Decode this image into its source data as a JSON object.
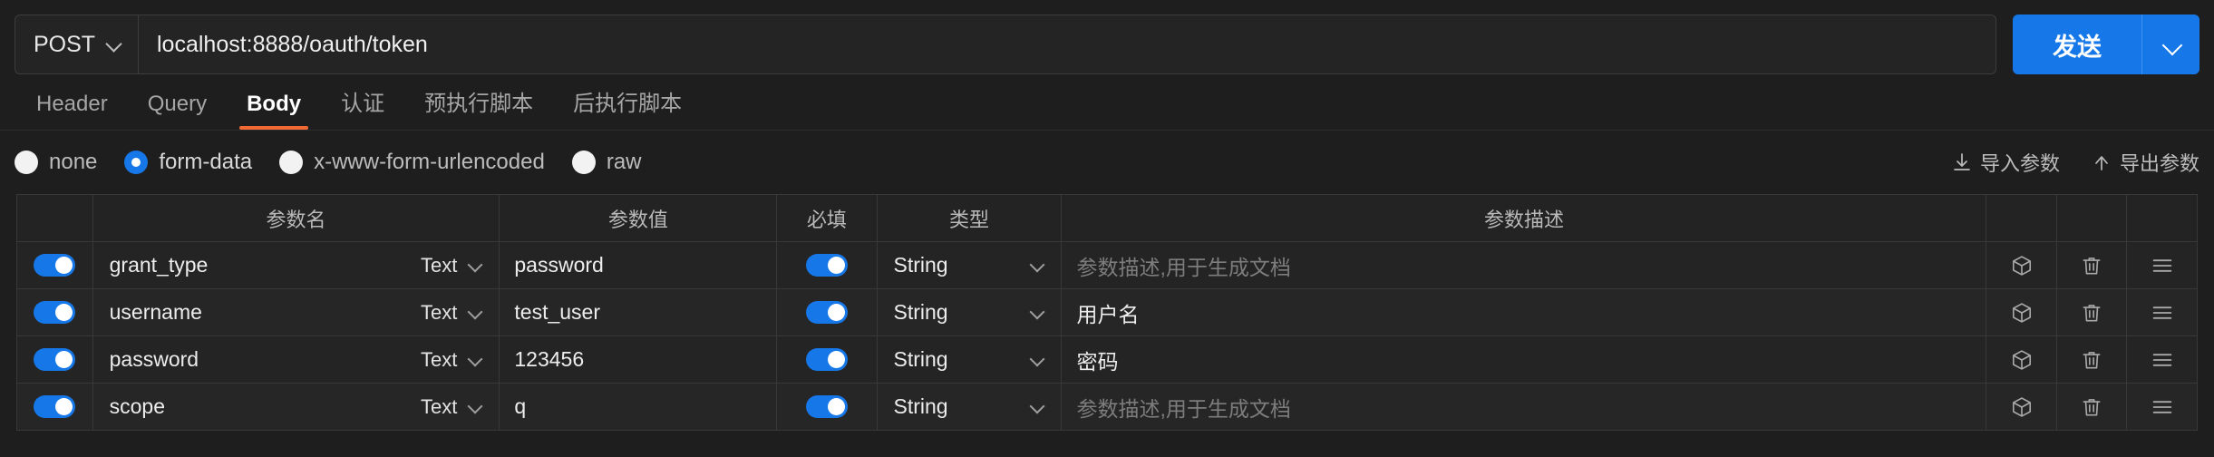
{
  "request": {
    "method": "POST",
    "url_value": "localhost:8888/oauth/token",
    "url_placeholder": "",
    "send_label": "发送",
    "method_caret_icon": "chevron-down-icon",
    "send_caret_icon": "chevron-down-icon"
  },
  "tabs": [
    {
      "label": "Header",
      "active": false
    },
    {
      "label": "Query",
      "active": false
    },
    {
      "label": "Body",
      "active": true
    },
    {
      "label": "认证",
      "active": false
    },
    {
      "label": "预执行脚本",
      "active": false
    },
    {
      "label": "后执行脚本",
      "active": false
    }
  ],
  "body_types": [
    {
      "label": "none",
      "selected": false
    },
    {
      "label": "form-data",
      "selected": true
    },
    {
      "label": "x-www-form-urlencoded",
      "selected": false
    },
    {
      "label": "raw",
      "selected": false
    }
  ],
  "io_actions": [
    {
      "label": "导入参数",
      "icon": "import-down-icon"
    },
    {
      "label": "导出参数",
      "icon": "export-up-icon"
    }
  ],
  "table": {
    "headers": [
      "",
      "参数名",
      "参数值",
      "必填",
      "类型",
      "参数描述",
      "",
      "",
      ""
    ],
    "desc_placeholder": "参数描述,用于生成文档",
    "row_icons": [
      "cube-icon",
      "trash-icon",
      "menu-icon"
    ],
    "rows": [
      {
        "enabled": true,
        "name": "grant_type",
        "name_type": "Text",
        "value": "password",
        "required": true,
        "type": "String",
        "desc": "",
        "desc_is_placeholder": true
      },
      {
        "enabled": true,
        "name": "username",
        "name_type": "Text",
        "value": "test_user",
        "required": true,
        "type": "String",
        "desc": "用户名",
        "desc_is_placeholder": false
      },
      {
        "enabled": true,
        "name": "password",
        "name_type": "Text",
        "value": "123456",
        "required": true,
        "type": "String",
        "desc": "密码",
        "desc_is_placeholder": false
      },
      {
        "enabled": true,
        "name": "scope",
        "name_type": "Text",
        "value": "q",
        "required": true,
        "type": "String",
        "desc": "",
        "desc_is_placeholder": true
      }
    ]
  },
  "colors": {
    "accent_blue": "#1677e8",
    "tab_underline": "#f26a33",
    "background": "#1e1e1e"
  }
}
